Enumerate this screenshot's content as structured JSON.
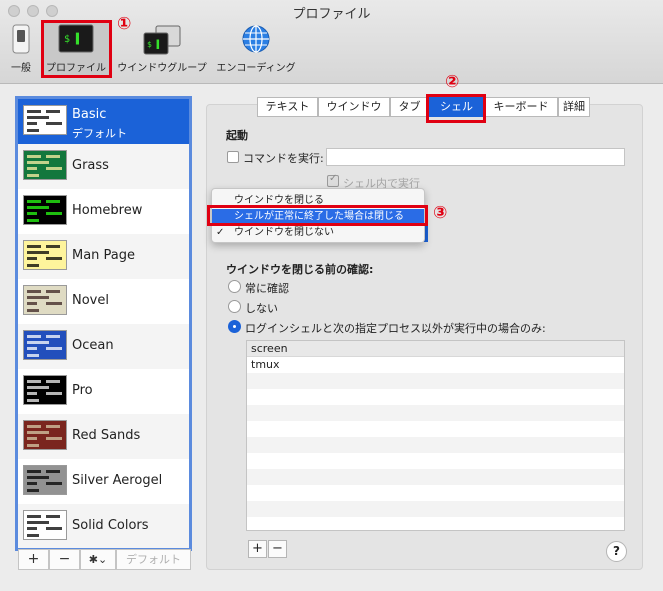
{
  "window": {
    "title": "プロファイル"
  },
  "toolbar": {
    "items": [
      {
        "label": "一般"
      },
      {
        "label": "プロファイル"
      },
      {
        "label": "ウインドウグループ"
      },
      {
        "label": "エンコーディング"
      }
    ],
    "icon_text_1": "$ ▌",
    "icon_text_2": "$ ▌",
    "icon_text_3": "$!"
  },
  "annotations": {
    "m1": "①",
    "m2": "②",
    "m3": "③"
  },
  "profiles": [
    {
      "name": "Basic",
      "subtitle": "デフォルト",
      "bg": "#ffffff",
      "fg": "#000000"
    },
    {
      "name": "Grass",
      "bg": "#13773d",
      "fg": "#fff0a5"
    },
    {
      "name": "Homebrew",
      "bg": "#000000",
      "fg": "#28fe14"
    },
    {
      "name": "Man Page",
      "bg": "#fef49c",
      "fg": "#000000"
    },
    {
      "name": "Novel",
      "bg": "#dfdbc3",
      "fg": "#3b2322"
    },
    {
      "name": "Ocean",
      "bg": "#224fbc",
      "fg": "#ffffff"
    },
    {
      "name": "Pro",
      "bg": "#000000",
      "fg": "#f2f2f2"
    },
    {
      "name": "Red Sands",
      "bg": "#7a251e",
      "fg": "#d7c9a7"
    },
    {
      "name": "Silver Aerogel",
      "bg": "#929292",
      "fg": "#000000"
    },
    {
      "name": "Solid Colors",
      "bg": "#ffffff",
      "fg": "#000000"
    }
  ],
  "list_buttons": {
    "add": "+",
    "remove": "−",
    "gear": "✱⌄",
    "default": "デフォルト"
  },
  "tabs": [
    "テキスト",
    "ウインドウ",
    "タブ",
    "シェル",
    "キーボード",
    "詳細"
  ],
  "shell": {
    "startup_heading": "起動",
    "run_command_label": "コマンドを実行:",
    "run_command_value": "",
    "run_in_shell_label": "シェル内で実行",
    "menu_items": [
      {
        "label": "ウインドウを閉じる",
        "checked": false,
        "highlighted": false
      },
      {
        "label": "シェルが正常に終了した場合は閉じる",
        "checked": false,
        "highlighted": true
      },
      {
        "label": "ウインドウを閉じない",
        "checked": true,
        "highlighted": false
      }
    ],
    "check_mark": "✓",
    "confirm_heading": "ウインドウを閉じる前の確認:",
    "radio_options": [
      {
        "label": "常に確認",
        "selected": false
      },
      {
        "label": "しない",
        "selected": false
      },
      {
        "label": "ログインシェルと次の指定プロセス以外が実行中の場合のみ:",
        "selected": true
      }
    ],
    "processes": [
      "screen",
      "tmux"
    ],
    "add": "+",
    "remove": "−",
    "help": "?"
  },
  "colors": {
    "accent": "#1b62d8",
    "annotation_red": "#e00012"
  }
}
